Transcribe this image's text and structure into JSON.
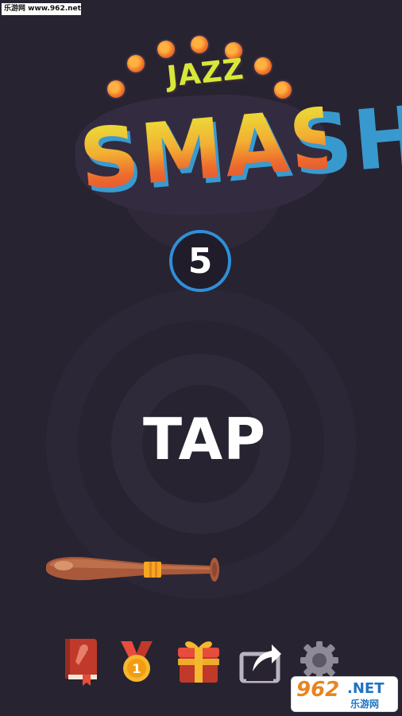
{
  "watermark": {
    "top_text": "乐游网 www.962.net"
  },
  "logo": {
    "jazz": "JAZZ",
    "smash": "SMASH"
  },
  "score": {
    "value": "5"
  },
  "prompt": {
    "tap": "TAP"
  },
  "toolbar": {
    "icons": [
      "book-icon",
      "medal-icon",
      "gift-icon",
      "share-icon",
      "gear-icon"
    ]
  },
  "badge": {
    "number": "962",
    "suffix": ".NET",
    "chinese": "乐游网"
  },
  "colors": {
    "background": "#282331",
    "accent_blue": "#2f8fd9",
    "logo_yellow": "#e7ef3b",
    "logo_orange": "#ee6a2d"
  }
}
